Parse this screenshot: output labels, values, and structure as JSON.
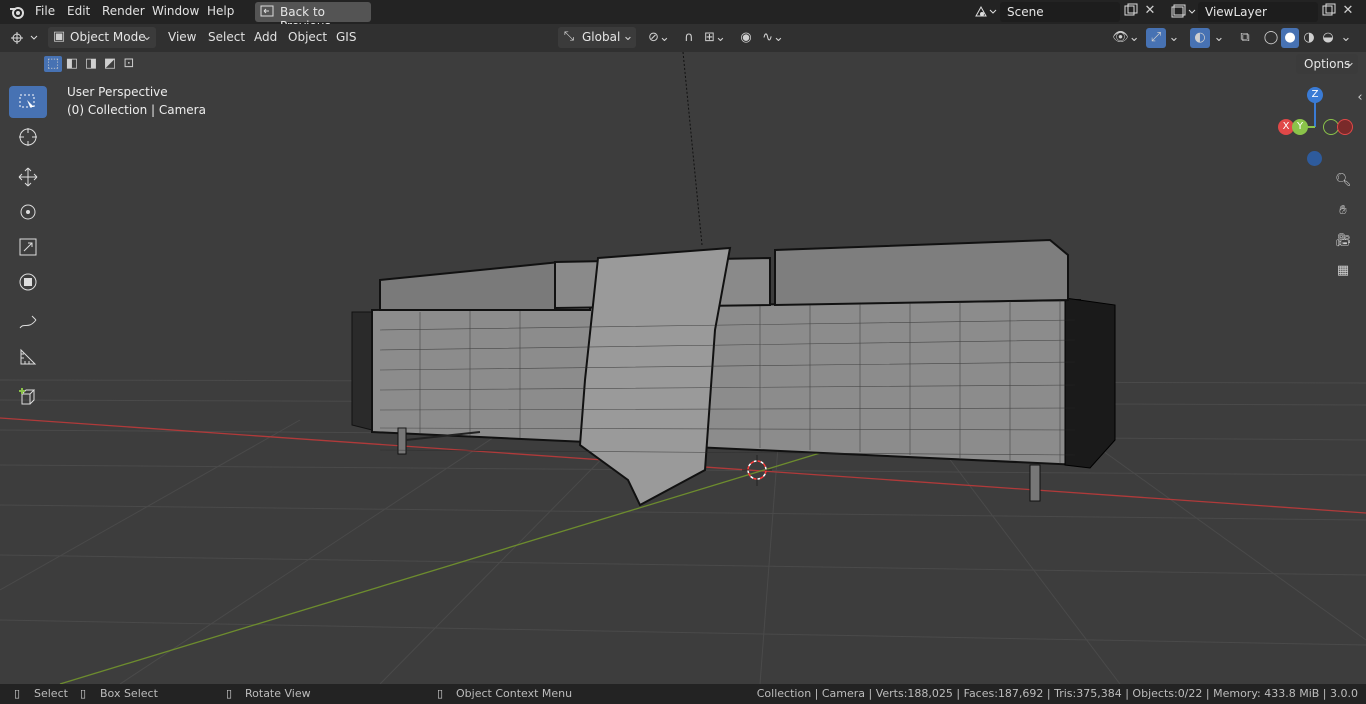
{
  "topbar": {
    "menus": [
      "File",
      "Edit",
      "Render",
      "Window",
      "Help"
    ],
    "back_button": "Back to Previous",
    "scene": "Scene",
    "view_layer": "ViewLayer"
  },
  "header": {
    "mode": "Object Mode",
    "menus": [
      "View",
      "Select",
      "Add",
      "Object",
      "GIS"
    ],
    "transform_orientation": "Global",
    "options": "Options"
  },
  "viewport": {
    "perspective": "User Perspective",
    "collection_info": "(0) Collection | Camera",
    "gizmo": {
      "z": "Z",
      "y": "Y",
      "x": "X"
    }
  },
  "statusbar": {
    "select": "Select",
    "box_select": "Box Select",
    "rotate_view": "Rotate View",
    "context_menu": "Object Context Menu",
    "stats": "Collection | Camera | Verts:188,025 | Faces:187,692 | Tris:375,384 | Objects:0/22 | Memory: 433.8 MiB | 3.0.0"
  },
  "colors": {
    "accent": "#4772b3",
    "x_axis": "#e04848",
    "y_axis": "#8bc34a",
    "z_axis": "#3a7bd5"
  }
}
